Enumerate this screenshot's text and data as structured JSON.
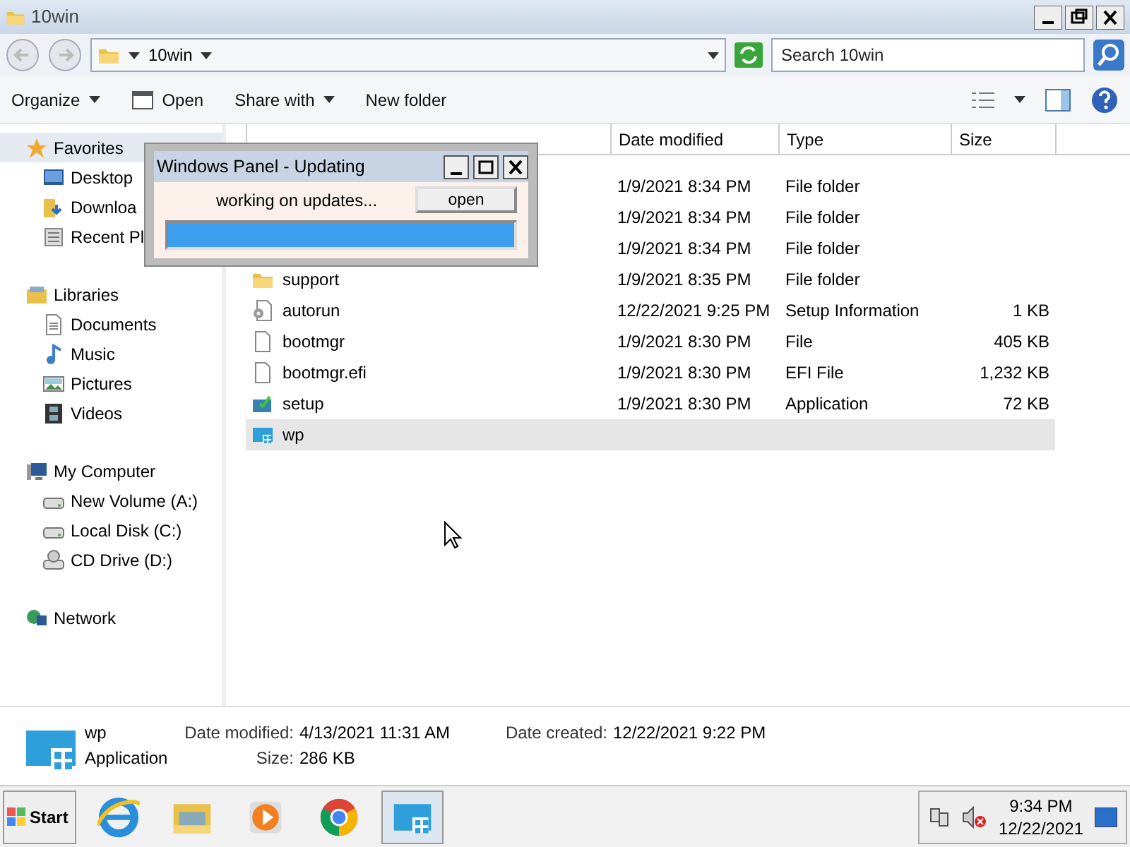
{
  "window": {
    "title": "10win"
  },
  "address": {
    "path": "10win",
    "search_placeholder": "Search 10win"
  },
  "toolbar": [
    {
      "label": "Organize",
      "dropdown": true,
      "kind": "plain"
    },
    {
      "label": "Open",
      "dropdown": false,
      "kind": "open"
    },
    {
      "label": "Share with",
      "dropdown": true,
      "kind": "plain"
    },
    {
      "label": "New folder",
      "dropdown": false,
      "kind": "plain"
    }
  ],
  "navigation": [
    {
      "label": "Favorites",
      "kind": "star",
      "selected": true,
      "children": [
        {
          "label": "Desktop",
          "kind": "desktop"
        },
        {
          "label": "Downloa",
          "kind": "download"
        },
        {
          "label": "Recent Pl",
          "kind": "recent"
        }
      ]
    },
    {
      "label": "Libraries",
      "kind": "library",
      "selected": false,
      "children": [
        {
          "label": "Documents",
          "kind": "document"
        },
        {
          "label": "Music",
          "kind": "music"
        },
        {
          "label": "Pictures",
          "kind": "pictures"
        },
        {
          "label": "Videos",
          "kind": "videos"
        }
      ]
    },
    {
      "label": "My Computer",
      "kind": "computer",
      "selected": false,
      "children": [
        {
          "label": "New Volume (A:)",
          "kind": "drive"
        },
        {
          "label": "Local Disk (C:)",
          "kind": "drive"
        },
        {
          "label": "CD Drive (D:)",
          "kind": "cd"
        }
      ]
    },
    {
      "label": "Network",
      "kind": "network",
      "selected": false
    }
  ],
  "table": {
    "columns": [
      "Date modified",
      "Type",
      "Size"
    ],
    "rows": [
      {
        "date": "1/9/2021 8:34 PM",
        "type": "File folder",
        "selected": false
      },
      {
        "date": "1/9/2021 8:34 PM",
        "type": "File folder",
        "selected": false
      },
      {
        "date": "1/9/2021 8:34 PM",
        "type": "File folder",
        "selected": false
      },
      {
        "kind": "folder",
        "name": "support",
        "date": "1/9/2021 8:35 PM",
        "type": "File folder",
        "selected": false
      },
      {
        "kind": "setup-info",
        "name": "autorun",
        "date": "12/22/2021 9:25 PM",
        "type": "Setup Information",
        "size": "1 KB",
        "selected": false
      },
      {
        "kind": "file",
        "name": "bootmgr",
        "date": "1/9/2021 8:30 PM",
        "type": "File",
        "size": "405 KB",
        "selected": false
      },
      {
        "kind": "file",
        "name": "bootmgr.efi",
        "date": "1/9/2021 8:30 PM",
        "type": "EFI File",
        "size": "1,232 KB",
        "selected": false
      },
      {
        "kind": "installer",
        "name": "setup",
        "date": "1/9/2021 8:30 PM",
        "type": "Application",
        "size": "72 KB",
        "selected": false
      },
      {
        "kind": "app",
        "name": "wp",
        "selected": true
      }
    ]
  },
  "details": {
    "name": "wp",
    "type": "Application",
    "fields": [
      {
        "label": "Date modified:",
        "value": "4/13/2021 11:31 AM"
      },
      {
        "label": "Size:",
        "value": "286 KB"
      },
      {
        "label": "Date created:",
        "value": "12/22/2021 9:22 PM"
      }
    ]
  },
  "dialog": {
    "title": "Windows Panel - Updating",
    "message": "working on updates...",
    "button": "open",
    "level": 1
  },
  "taskbar": {
    "start": "Start",
    "apps": [
      {
        "kind": "browser-e",
        "selected": false
      },
      {
        "kind": "explorer",
        "selected": false
      },
      {
        "kind": "media",
        "selected": false
      },
      {
        "kind": "chrome",
        "selected": false
      },
      {
        "kind": "app",
        "selected": true
      }
    ],
    "time": "9:34 PM",
    "date": "12/22/2021"
  }
}
